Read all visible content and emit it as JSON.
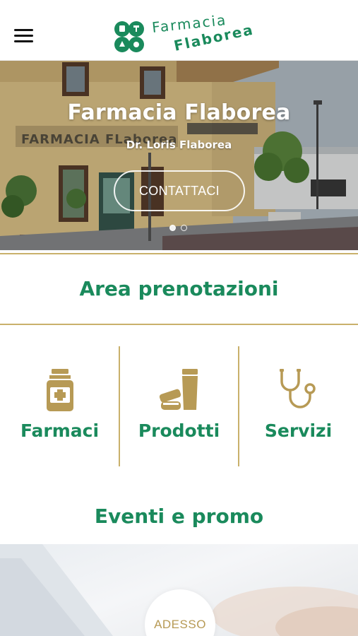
{
  "header": {
    "menu_icon": "hamburger-menu-icon",
    "logo": {
      "line1": "Farmacia",
      "line2": "Flaborea",
      "mark_icon": "four-leaf-clover-logo"
    }
  },
  "hero": {
    "title": "Farmacia Flaborea",
    "subtitle": "Dr. Loris Flaborea",
    "cta_label": "CONTATTACI",
    "slides_total": 2,
    "active_slide": 1,
    "storefront_sign": "FARMACIA FLaborea"
  },
  "booking": {
    "title": "Area prenotazioni",
    "items": [
      {
        "label": "Farmaci",
        "icon": "medicine-bottle-icon"
      },
      {
        "label": "Prodotti",
        "icon": "cosmetic-products-icon"
      },
      {
        "label": "Servizi",
        "icon": "stethoscope-icon"
      }
    ]
  },
  "events": {
    "title": "Eventi e promo",
    "badge": "ADESSO"
  },
  "colors": {
    "brand_green": "#1a8a5c",
    "gold": "#c9b06b",
    "gold_dark": "#b79a55"
  }
}
